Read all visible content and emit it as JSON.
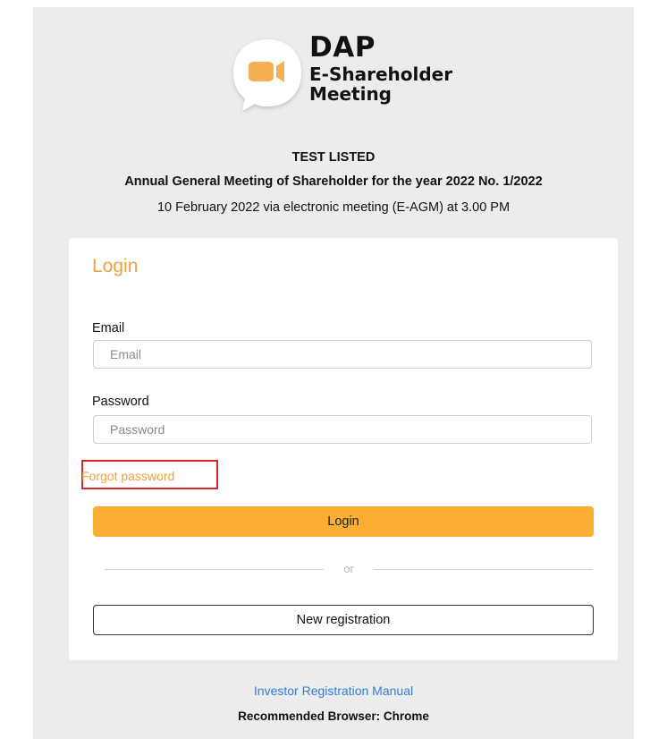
{
  "brand": {
    "logo_line1": "DAP",
    "logo_line2": "E-Shareholder",
    "logo_line3": "Meeting",
    "bubble_color": "#ffffff",
    "camera_color": "#f5b04f"
  },
  "meeting": {
    "company": "TEST LISTED",
    "title": "Annual General Meeting of Shareholder for the year 2022 No. 1/2022",
    "date_line": "10 February 2022 via electronic meeting (E-AGM) at 3.00 PM"
  },
  "login_form": {
    "heading": "Login",
    "email_label": "Email",
    "email_placeholder": "Email",
    "email_value": "",
    "password_label": "Password",
    "password_placeholder": "Password",
    "password_value": "",
    "forgot_password": "Forgot password",
    "login_button": "Login",
    "divider_text": "or",
    "register_button": "New registration"
  },
  "footer": {
    "manual_link": "Investor Registration Manual",
    "browser_note": "Recommended Browser: Chrome"
  },
  "colors": {
    "accent": "#f2a13a",
    "button": "#fbae34",
    "link": "#2f7fe0",
    "highlight_box": "#e02424",
    "page_bg": "#ececec"
  }
}
